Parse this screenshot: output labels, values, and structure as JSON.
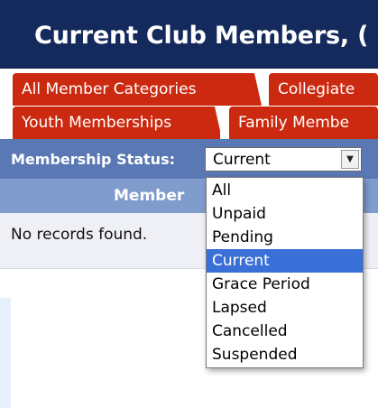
{
  "header": {
    "title": "Current Club Members, ("
  },
  "tabs": [
    {
      "label": "All Member Categories"
    },
    {
      "label": "Collegiate"
    },
    {
      "label": "Youth Memberships"
    },
    {
      "label": "Family Membe"
    }
  ],
  "filter": {
    "label": "Membership Status:",
    "selected": "Current",
    "options": [
      "All",
      "Unpaid",
      "Pending",
      "Current",
      "Grace Period",
      "Lapsed",
      "Cancelled",
      "Suspended"
    ]
  },
  "table": {
    "column_header": "Member",
    "empty_message": "No records found."
  },
  "colors": {
    "header_bg": "#142a5c",
    "tab_bg": "#cc2a10",
    "status_bar_bg": "#5a78b4",
    "column_header_bg": "#7f9ccd",
    "selected_option_bg": "#3a6fd8"
  }
}
